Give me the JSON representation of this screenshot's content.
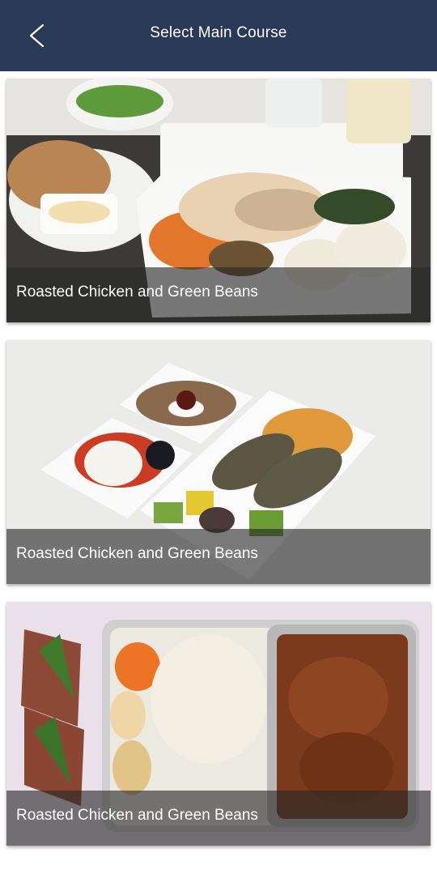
{
  "header": {
    "title": "Select Main Course",
    "back_icon": "chevron-left-icon",
    "background_color": "#283a55"
  },
  "meals": [
    {
      "title": "Roasted Chicken and Green Beans",
      "image": "roasted chicken meal tray photo"
    },
    {
      "title": "Roasted Chicken and Green Beans",
      "image": "kofta with rice and caprese salad photo"
    },
    {
      "title": "Roasted Chicken and Green Beans",
      "image": "vegetable rice with curry tray photo"
    }
  ]
}
